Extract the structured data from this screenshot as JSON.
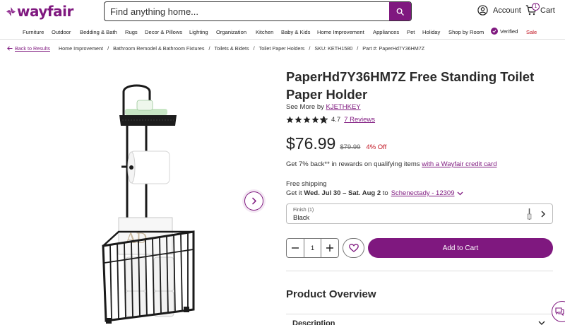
{
  "brand": {
    "logo_text": "wayfair",
    "accent": "#7f187f",
    "sale_color": "#c1121f"
  },
  "search": {
    "placeholder": "Find anything home..."
  },
  "header": {
    "account_label": "Account",
    "cart_label": "Cart",
    "cart_count": "1"
  },
  "nav": {
    "items": [
      "Furniture",
      "Outdoor",
      "Bedding & Bath",
      "Rugs",
      "Decor & Pillows",
      "Lighting",
      "Organization",
      "Kitchen",
      "Baby & Kids",
      "Home Improvement",
      "Appliances",
      "Pet",
      "Holiday",
      "Shop by Room",
      "Verified",
      "Sale"
    ]
  },
  "breadcrumb": {
    "back": "Back to Results",
    "items": [
      "Home Improvement",
      "Bathroom Remodel & Bathroom Fixtures",
      "Toilets & Bidets",
      "Toilet Paper Holders",
      "SKU: KETH1580",
      "Part #: PaperHd7Y36HM7Z"
    ]
  },
  "product": {
    "title": "PaperHd7Y36HM7Z Free Standing Toilet Paper Holder",
    "see_more_prefix": "See More by",
    "brand": "KJETHKEY",
    "rating": "4.7",
    "rating_value": 4.7,
    "reviews": "7 Reviews",
    "price": "$76.99",
    "was_price": "$79.99",
    "discount": "4% Off",
    "rewards_text": "Get 7% back** in rewards on qualifying items",
    "rewards_link": "with a Wayfair credit card",
    "shipping_title": "Free shipping",
    "shipping_prefix": "Get it",
    "shipping_dates": "Wed. Jul 30 – Sat. Aug 2",
    "shipping_to": "to",
    "shipping_location": "Schenectady - 12309",
    "finish_label": "Finish (1)",
    "finish_value": "Black",
    "quantity": "1",
    "add_to_cart": "Add to Cart",
    "overview_heading": "Product Overview",
    "description_label": "Description"
  }
}
